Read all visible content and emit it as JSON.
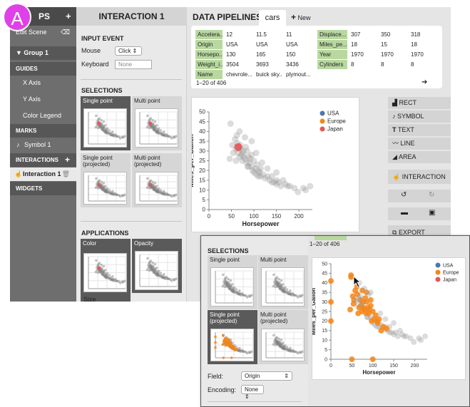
{
  "badge": "A",
  "sidebar": {
    "title": "PS",
    "add": "+",
    "edit_scene": "Edit Scene",
    "group": "▼  Group 1",
    "guides": "GUIDES",
    "x_axis": "X Axis",
    "y_axis": "Y Axis",
    "color_legend": "Color Legend",
    "marks": "MARKS",
    "symbol": "Symbol 1",
    "interactions": "INTERACTIONS",
    "interactions_add": "+",
    "interaction": "Interaction 1",
    "widgets": "WIDGETS"
  },
  "inspector": {
    "title": "INTERACTION 1",
    "input_event": "INPUT EVENT",
    "mouse_label": "Mouse",
    "mouse_value": "Click ⇕",
    "keyboard_label": "Keyboard",
    "keyboard_placeholder": "None",
    "selections": "SELECTIONS",
    "single_point": "Single point",
    "multi_point": "Multi point",
    "single_proj": "Single point (projected)",
    "multi_proj": "Multi point (projected)",
    "applications": "APPLICATIONS",
    "color": "Color",
    "opacity": "Opacity",
    "size": "Size"
  },
  "pipelines": {
    "title": "DATA PIPELINES",
    "tab": "cars",
    "new_plus": "+",
    "new_label": "New",
    "count": "1–20 of 406",
    "next": "➔",
    "table_left": [
      [
        "Accelera...",
        "12",
        "11.5",
        "11"
      ],
      [
        "Origin",
        "USA",
        "USA",
        "USA"
      ],
      [
        "Horsepo...",
        "130",
        "165",
        "150"
      ],
      [
        "Weight_i...",
        "3504",
        "3693",
        "3436"
      ],
      [
        "Name",
        "chevrole...",
        "buick sky...",
        "plymout..."
      ]
    ],
    "table_right": [
      [
        "Displace...",
        "307",
        "350",
        "318"
      ],
      [
        "Miles_pe...",
        "18",
        "15",
        "18"
      ],
      [
        "Year",
        "1970",
        "1970",
        "1970"
      ],
      [
        "Cylinders",
        "8",
        "8",
        "8"
      ]
    ]
  },
  "tools": {
    "rect": "RECT",
    "symbol": "SYMBOL",
    "text": "TEXT",
    "line": "LINE",
    "area": "AREA",
    "interaction": "INTERACTION",
    "undo": "↺",
    "redo": "↻",
    "open": "▬",
    "save": "▣",
    "export": "EXPORT",
    "rect_icon": "▟",
    "symbol_icon": "♪",
    "text_icon": "T",
    "line_icon": "〰",
    "area_icon": "◢",
    "interaction_icon": "☝",
    "export_icon": "⧉"
  },
  "overlay": {
    "selections": "SELECTIONS",
    "single_point": "Single point",
    "multi_point": "Multi point",
    "single_proj": "Single point (projected)",
    "multi_proj": "Multi point (projected)",
    "field_label": "Field:",
    "field_value": "Origin",
    "encoding_label": "Encoding:",
    "encoding_value": "None ⇕",
    "count": "1–20 of 406"
  },
  "colors": {
    "usa": "#4c78a8",
    "europe": "#f58518",
    "japan": "#e45756",
    "grey": "#9a9a9a",
    "accent_badge": "#e040e8"
  },
  "chart_data": [
    {
      "type": "scatter",
      "xlabel": "Horsepower",
      "ylabel": "Miles_per_Gallon",
      "xlim": [
        0,
        230
      ],
      "ylim": [
        0,
        50
      ],
      "xticks": [
        0,
        50,
        100,
        150,
        200
      ],
      "yticks": [
        0,
        5,
        10,
        15,
        20,
        25,
        30,
        35,
        40,
        45,
        50
      ],
      "legend": [
        "USA",
        "Europe",
        "Japan"
      ],
      "legend_position": "top-right",
      "highlight": {
        "series": "Japan",
        "x": [
          65
        ],
        "y": [
          32
        ]
      },
      "series": [
        {
          "name": "All",
          "points": [
            [
              46,
              26
            ],
            [
              48,
              44
            ],
            [
              52,
              33
            ],
            [
              54,
              29
            ],
            [
              58,
              36
            ],
            [
              60,
              31
            ],
            [
              62,
              38
            ],
            [
              63,
              34
            ],
            [
              65,
              29
            ],
            [
              67,
              32
            ],
            [
              68,
              27
            ],
            [
              70,
              33
            ],
            [
              70,
              31
            ],
            [
              72,
              28
            ],
            [
              74,
              25
            ],
            [
              75,
              29
            ],
            [
              76,
              30
            ],
            [
              78,
              27
            ],
            [
              80,
              26
            ],
            [
              82,
              32
            ],
            [
              84,
              24
            ],
            [
              85,
              30
            ],
            [
              88,
              22
            ],
            [
              88,
              27
            ],
            [
              90,
              24
            ],
            [
              92,
              26
            ],
            [
              95,
              22
            ],
            [
              95,
              28
            ],
            [
              97,
              20
            ],
            [
              100,
              25
            ],
            [
              100,
              19
            ],
            [
              103,
              21
            ],
            [
              105,
              18
            ],
            [
              107,
              23
            ],
            [
              110,
              17
            ],
            [
              110,
              20
            ],
            [
              112,
              19
            ],
            [
              115,
              21
            ],
            [
              115,
              17
            ],
            [
              120,
              18
            ],
            [
              125,
              16
            ],
            [
              130,
              17
            ],
            [
              135,
              15
            ],
            [
              140,
              14
            ],
            [
              145,
              14
            ],
            [
              150,
              13
            ],
            [
              150,
              15
            ],
            [
              155,
              14
            ],
            [
              160,
              12
            ],
            [
              165,
              15
            ],
            [
              170,
              13
            ],
            [
              175,
              12
            ],
            [
              180,
              12
            ],
            [
              190,
              11
            ],
            [
              198,
              9
            ],
            [
              210,
              11
            ],
            [
              215,
              10
            ],
            [
              225,
              12
            ],
            [
              68,
              40
            ],
            [
              80,
              37
            ],
            [
              95,
              35
            ],
            [
              105,
              29
            ],
            [
              118,
              24
            ],
            [
              130,
              21
            ],
            [
              60,
              25
            ],
            [
              86,
              22
            ],
            [
              140,
              17
            ],
            [
              150,
              19
            ]
          ]
        }
      ]
    },
    {
      "type": "scatter",
      "xlabel": "Horsepower",
      "ylabel": "Miles_per_Gallon",
      "xlim": [
        0,
        230
      ],
      "ylim": [
        0,
        50
      ],
      "xticks": [
        0,
        50,
        100,
        150,
        200
      ],
      "yticks": [
        0,
        5,
        10,
        15,
        20,
        25,
        30,
        35,
        40,
        45,
        50
      ],
      "legend": [
        "USA",
        "Europe",
        "Japan"
      ],
      "legend_position": "top-right",
      "series": [
        {
          "name": "USA",
          "points": [
            [
              88,
              22
            ],
            [
              95,
              22
            ],
            [
              100,
              19
            ],
            [
              105,
              18
            ],
            [
              110,
              17
            ],
            [
              115,
              17
            ],
            [
              120,
              18
            ],
            [
              125,
              16
            ],
            [
              130,
              17
            ],
            [
              135,
              15
            ],
            [
              140,
              14
            ],
            [
              145,
              14
            ],
            [
              150,
              13
            ],
            [
              155,
              14
            ],
            [
              160,
              12
            ],
            [
              165,
              15
            ],
            [
              170,
              13
            ],
            [
              175,
              12
            ],
            [
              180,
              12
            ],
            [
              190,
              11
            ],
            [
              198,
              9
            ],
            [
              210,
              11
            ],
            [
              215,
              10
            ],
            [
              225,
              12
            ],
            [
              140,
              17
            ],
            [
              150,
              19
            ],
            [
              130,
              21
            ],
            [
              118,
              24
            ]
          ]
        },
        {
          "name": "Europe",
          "points": [
            [
              46,
              26
            ],
            [
              48,
              44
            ],
            [
              48,
              43
            ],
            [
              52,
              33
            ],
            [
              54,
              29
            ],
            [
              58,
              36
            ],
            [
              62,
              38
            ],
            [
              63,
              34
            ],
            [
              67,
              27
            ],
            [
              70,
              31
            ],
            [
              72,
              28
            ],
            [
              74,
              25
            ],
            [
              76,
              30
            ],
            [
              78,
              27
            ],
            [
              80,
              26
            ],
            [
              82,
              32
            ],
            [
              84,
              24
            ],
            [
              85,
              30
            ],
            [
              88,
              27
            ],
            [
              90,
              24
            ],
            [
              92,
              26
            ],
            [
              95,
              28
            ],
            [
              97,
              20
            ],
            [
              100,
              25
            ],
            [
              103,
              21
            ],
            [
              107,
              23
            ],
            [
              110,
              20
            ],
            [
              112,
              19
            ],
            [
              115,
              21
            ],
            [
              120,
              15
            ],
            [
              125,
              17
            ],
            [
              133,
              16
            ],
            [
              0,
              41
            ],
            [
              0,
              30
            ],
            [
              0,
              20
            ],
            [
              50,
              0
            ],
            [
              100,
              0
            ],
            [
              55,
              31
            ],
            [
              65,
              24
            ],
            [
              75,
              36
            ],
            [
              85,
              35
            ],
            [
              95,
              31
            ]
          ]
        },
        {
          "name": "Japan",
          "points": [
            [
              60,
              31
            ],
            [
              65,
              29
            ],
            [
              67,
              32
            ],
            [
              70,
              33
            ],
            [
              75,
              29
            ],
            [
              80,
              37
            ],
            [
              68,
              40
            ],
            [
              86,
              22
            ],
            [
              90,
              34
            ],
            [
              95,
              35
            ]
          ]
        }
      ]
    }
  ]
}
